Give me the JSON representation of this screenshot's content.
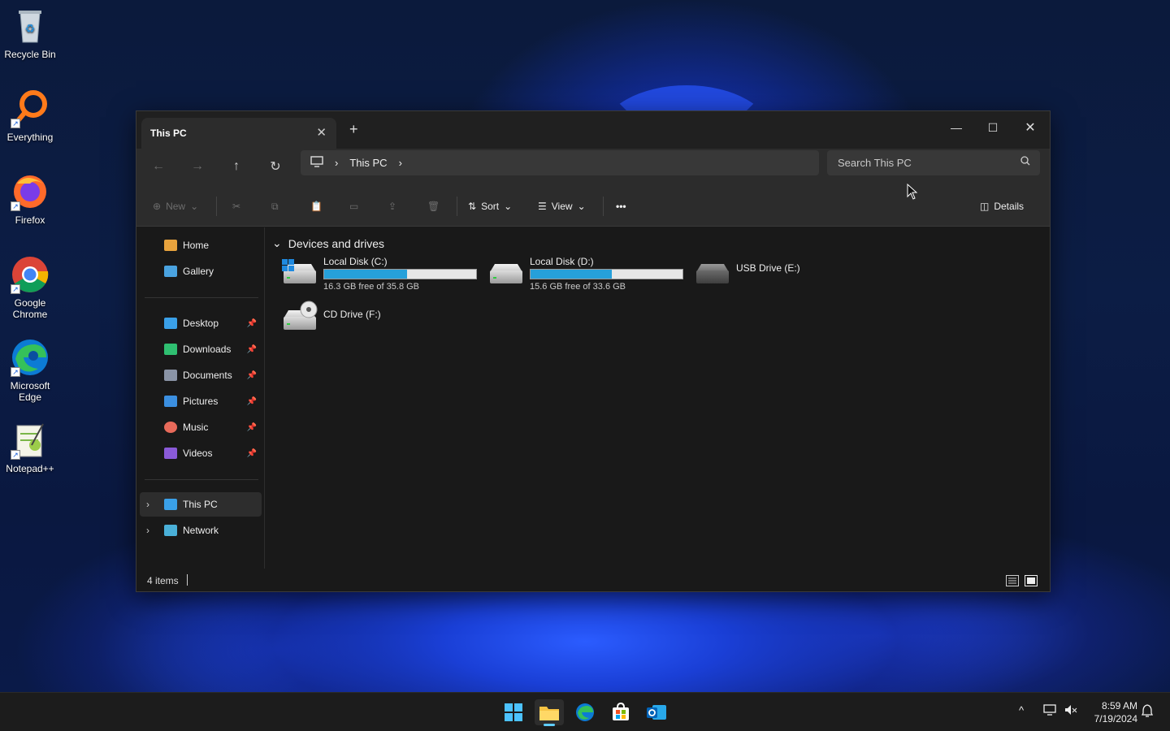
{
  "desktop": {
    "icons": [
      {
        "label": "Recycle Bin",
        "icon": "recycle-bin-icon"
      },
      {
        "label": "Everything",
        "icon": "everything-search-icon"
      },
      {
        "label": "Firefox",
        "icon": "firefox-icon"
      },
      {
        "label": "Google Chrome",
        "icon": "chrome-icon"
      },
      {
        "label": "Microsoft Edge",
        "icon": "edge-icon"
      },
      {
        "label": "Notepad++",
        "icon": "notepad-plus-plus-icon"
      }
    ]
  },
  "window": {
    "tab_title": "This PC",
    "tab_close": "✕",
    "new_tab": "+",
    "controls": {
      "minimize": "—",
      "maximize": "☐",
      "close": "✕"
    }
  },
  "navbar": {
    "back": "←",
    "forward": "→",
    "up": "↑",
    "refresh": "↻",
    "breadcrumb": [
      "This PC"
    ],
    "separator": "›",
    "search_placeholder": "Search This PC"
  },
  "toolbar": {
    "new_label": "New",
    "sort_label": "Sort",
    "view_label": "View",
    "more_label": "•••",
    "details_label": "Details"
  },
  "sidebar": {
    "quick": [
      {
        "label": "Home",
        "icon": "home-icon",
        "color": "#e8a33d"
      },
      {
        "label": "Gallery",
        "icon": "gallery-icon",
        "color": "#4aa3e0"
      }
    ],
    "pinned": [
      {
        "label": "Desktop",
        "icon": "desktop-folder-icon",
        "color": "#3aa0e8"
      },
      {
        "label": "Downloads",
        "icon": "downloads-icon",
        "color": "#2fbf71"
      },
      {
        "label": "Documents",
        "icon": "documents-icon",
        "color": "#8a94a6"
      },
      {
        "label": "Pictures",
        "icon": "pictures-icon",
        "color": "#3b8fe0"
      },
      {
        "label": "Music",
        "icon": "music-icon",
        "color": "#e86a5a"
      },
      {
        "label": "Videos",
        "icon": "videos-icon",
        "color": "#8a5ad8"
      }
    ],
    "roots": [
      {
        "label": "This PC",
        "icon": "this-pc-icon",
        "color": "#3aa0e8",
        "selected": true
      },
      {
        "label": "Network",
        "icon": "network-icon",
        "color": "#4ab0d8",
        "selected": false
      }
    ],
    "pin_glyph": "📌",
    "expand_glyph": "›"
  },
  "content": {
    "group_title": "Devices and drives",
    "group_chevron": "⌄",
    "drives": [
      {
        "name": "Local Disk (C:)",
        "free": "16.3 GB free of 35.8 GB",
        "used_fraction": 0.545,
        "windows": true
      },
      {
        "name": "Local Disk (D:)",
        "free": "15.6 GB free of 33.6 GB",
        "used_fraction": 0.536,
        "windows": false
      },
      {
        "name": "USB Drive (E:)",
        "free": "",
        "used_fraction": null,
        "windows": false
      },
      {
        "name": "CD Drive (F:)",
        "free": "",
        "used_fraction": null,
        "windows": false
      }
    ]
  },
  "status": {
    "item_count": "4 items"
  },
  "taskbar": {
    "apps": [
      "start-icon",
      "file-explorer-icon",
      "edge-icon",
      "store-icon",
      "outlook-icon"
    ],
    "time": "8:59 AM",
    "date": "7/19/2024"
  },
  "colors": {
    "accent": "#26a0da",
    "window_bg": "#191919",
    "chrome_bg": "#2c2c2c"
  }
}
